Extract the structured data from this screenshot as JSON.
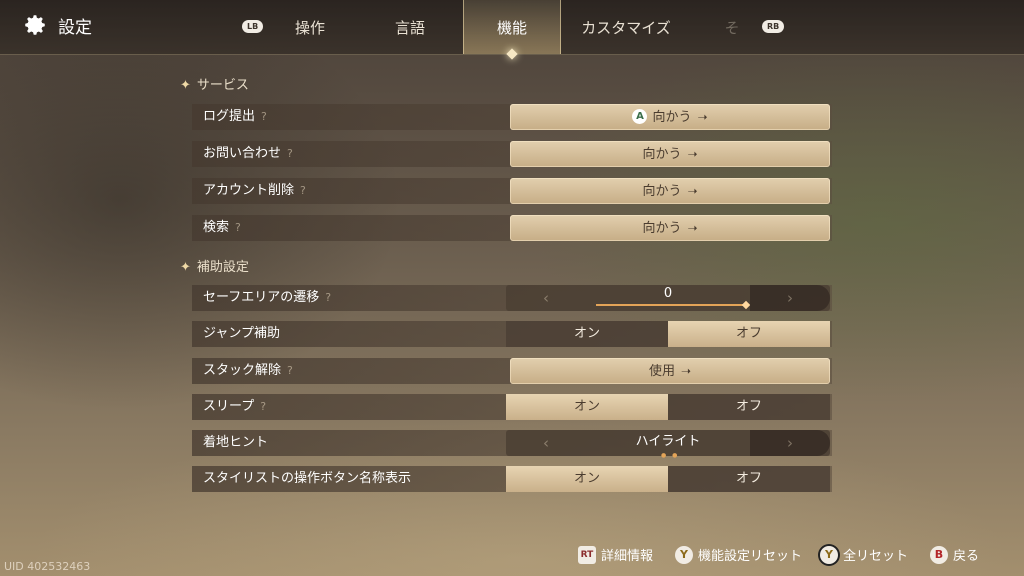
{
  "window": {
    "title": "設定"
  },
  "tabs": {
    "lb": "LB",
    "rb": "RB",
    "items": [
      {
        "label": "操作"
      },
      {
        "label": "言語"
      },
      {
        "label": "機能",
        "active": true
      },
      {
        "label": "カスタマイズ"
      },
      {
        "label": "そ"
      }
    ]
  },
  "sections": {
    "service": "サービス",
    "assist": "補助設定"
  },
  "rows": {
    "log": {
      "label": "ログ提出",
      "help": "?",
      "button": "向かう",
      "badge": "A"
    },
    "contact": {
      "label": "お問い合わせ",
      "help": "?",
      "button": "向かう"
    },
    "delete_account": {
      "label": "アカウント削除",
      "help": "?",
      "button": "向かう"
    },
    "search": {
      "label": "検索",
      "help": "?",
      "button": "向かう"
    },
    "safe_area": {
      "label": "セーフエリアの遷移",
      "help": "?",
      "value": "0"
    },
    "jump_assist": {
      "label": "ジャンプ補助",
      "on": "オン",
      "off": "オフ",
      "selected": "off"
    },
    "unstuck": {
      "label": "スタック解除",
      "help": "?",
      "button": "使用"
    },
    "sleep": {
      "label": "スリープ",
      "help": "?",
      "on": "オン",
      "off": "オフ",
      "selected": "on"
    },
    "landing_hint": {
      "label": "着地ヒント",
      "value": "ハイライト"
    },
    "stylist": {
      "label": "スタイリストの操作ボタン名称表示",
      "on": "オン",
      "off": "オフ",
      "selected": "on"
    }
  },
  "footer": {
    "uid": "UID 402532463",
    "details": {
      "key": "RT",
      "label": "詳細情報"
    },
    "reset_function": {
      "key": "Y",
      "label": "機能設定リセット"
    },
    "reset_all": {
      "key": "Y",
      "label": "全リセット"
    },
    "back": {
      "key": "B",
      "label": "戻る"
    }
  },
  "colors": {
    "accent": "#e3a458",
    "button": "#d9c3a0"
  }
}
